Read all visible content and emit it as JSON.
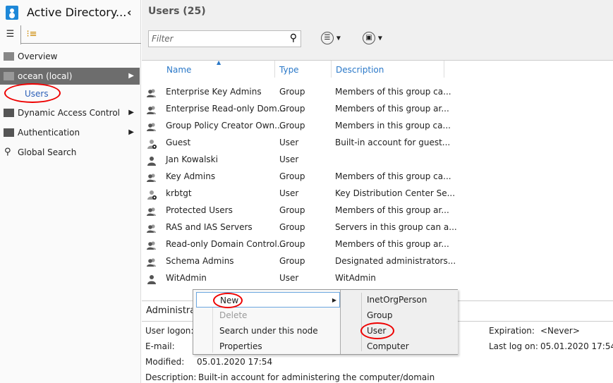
{
  "app": {
    "title": "Active Directory...",
    "collapse": "‹"
  },
  "left_tabs": [
    "list-view",
    "tree-view"
  ],
  "nav": [
    {
      "label": "Overview"
    },
    {
      "label": "ocean (local)"
    },
    {
      "label": "Users"
    },
    {
      "label": "Dynamic Access Control"
    },
    {
      "label": "Authentication"
    },
    {
      "label": "Global Search"
    }
  ],
  "main": {
    "title": "Users  (25)",
    "filter_placeholder": "Filter"
  },
  "columns": [
    "Name",
    "Type",
    "Description"
  ],
  "rows": [
    {
      "name": "Enterprise Key Admins",
      "type": "Group",
      "desc": "Members of this group ca...",
      "icon": "group"
    },
    {
      "name": "Enterprise Read-only Dom...",
      "type": "Group",
      "desc": "Members of this group ar...",
      "icon": "group"
    },
    {
      "name": "Group Policy Creator Own...",
      "type": "Group",
      "desc": "Members in this group ca...",
      "icon": "group"
    },
    {
      "name": "Guest",
      "type": "User",
      "desc": "Built-in account for guest...",
      "icon": "user-disabled"
    },
    {
      "name": "Jan Kowalski",
      "type": "User",
      "desc": "",
      "icon": "user"
    },
    {
      "name": "Key Admins",
      "type": "Group",
      "desc": "Members of this group ca...",
      "icon": "group"
    },
    {
      "name": "krbtgt",
      "type": "User",
      "desc": "Key Distribution Center Se...",
      "icon": "user-disabled"
    },
    {
      "name": "Protected Users",
      "type": "Group",
      "desc": "Members of this group ar...",
      "icon": "group"
    },
    {
      "name": "RAS and IAS Servers",
      "type": "Group",
      "desc": "Servers in this group can a...",
      "icon": "group"
    },
    {
      "name": "Read-only Domain Control...",
      "type": "Group",
      "desc": "Members of this group ar...",
      "icon": "group"
    },
    {
      "name": "Schema Admins",
      "type": "Group",
      "desc": "Designated administrators...",
      "icon": "group"
    },
    {
      "name": "WitAdmin",
      "type": "User",
      "desc": "WitAdmin",
      "icon": "user"
    }
  ],
  "details": {
    "title": "Administra",
    "user_logon_label": "User logon:",
    "email_label": "E-mail:",
    "modified_label": "Modified:",
    "modified": "05.01.2020 17:54",
    "description_label": "Description:",
    "description": "Built-in account for administering the computer/domain",
    "expiration_label": "Expiration:",
    "expiration": "<Never>",
    "last_logon_label": "Last log on:",
    "last_logon": "05.01.2020 17:54"
  },
  "context_menu": {
    "items": [
      "New",
      "Delete",
      "Search under this node",
      "Properties"
    ],
    "submenu": [
      "InetOrgPerson",
      "Group",
      "User",
      "Computer"
    ]
  },
  "colors": {
    "accent": "#2a78c8",
    "selected_nav": "#6d6d6d",
    "annotation": "#e00000"
  }
}
